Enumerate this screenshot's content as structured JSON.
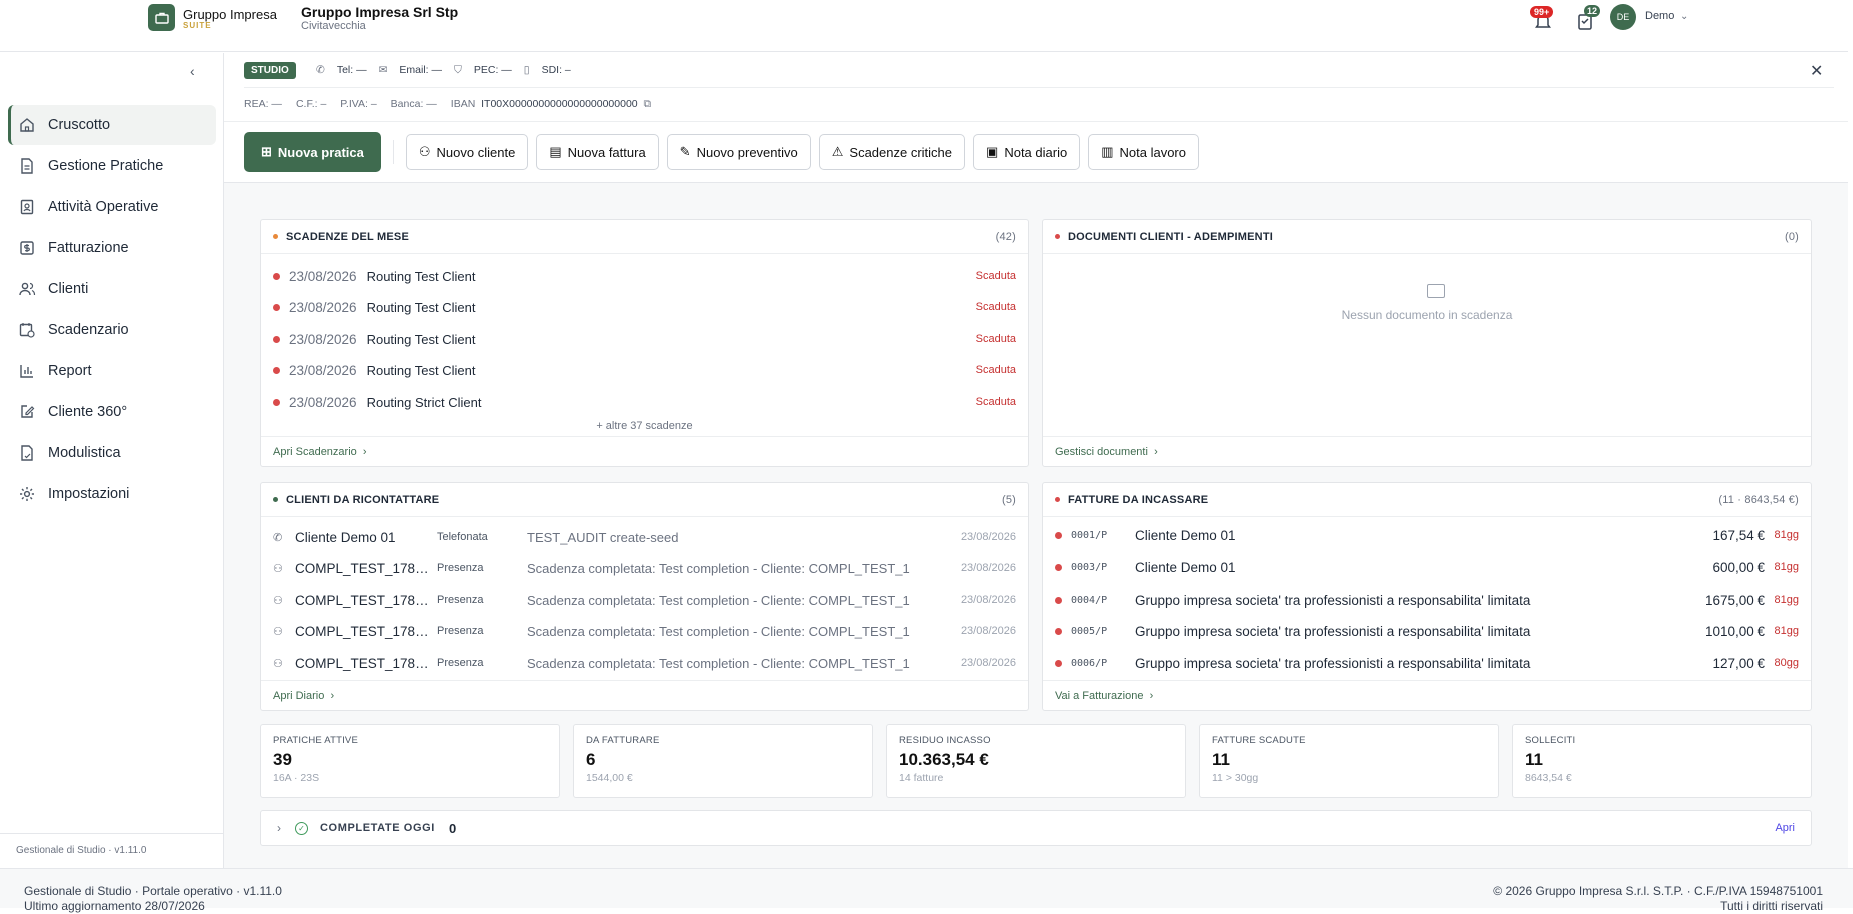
{
  "header": {
    "brand_name": "Gruppo Impresa",
    "brand_suite": "SUITE",
    "company_name": "Gruppo Impresa Srl Stp",
    "company_city": "Civitavecchia",
    "notifications_badge": "99+",
    "tasks_badge": "12",
    "user_initials": "DE",
    "user_name": "Demo"
  },
  "sidebar": {
    "items": [
      {
        "label": "Cruscotto",
        "icon": "home-icon"
      },
      {
        "label": "Gestione Pratiche",
        "icon": "document-icon"
      },
      {
        "label": "Attività Operative",
        "icon": "clipboard-icon"
      },
      {
        "label": "Fatturazione",
        "icon": "dollar-icon"
      },
      {
        "label": "Clienti",
        "icon": "users-icon"
      },
      {
        "label": "Scadenzario",
        "icon": "calendar-clock-icon"
      },
      {
        "label": "Report",
        "icon": "bar-chart-icon"
      },
      {
        "label": "Cliente 360°",
        "icon": "edit-icon"
      },
      {
        "label": "Modulistica",
        "icon": "form-icon"
      },
      {
        "label": "Impostazioni",
        "icon": "gear-icon"
      }
    ],
    "version": "Gestionale di Studio · v1.11.0"
  },
  "studio_info": {
    "chip": "STUDIO",
    "tel": "Tel: —",
    "email": "Email: —",
    "pec": "PEC: —",
    "sdi": "SDI: –",
    "rea": "REA: —",
    "cf": "C.F.: –",
    "piva": "P.IVA: –",
    "banca": "Banca: —",
    "iban_label": "IBAN",
    "iban": "IT00X0000000000000000000000"
  },
  "actions": {
    "new_practice": "Nuova pratica",
    "new_client": "Nuovo cliente",
    "new_invoice": "Nuova fattura",
    "new_quote": "Nuovo preventivo",
    "critical_deadlines": "Scadenze critiche",
    "diary_note": "Nota diario",
    "work_note": "Nota lavoro"
  },
  "deadlines": {
    "title": "SCADENZE DEL MESE",
    "count": "(42)",
    "rows": [
      {
        "date": "23/08/2026",
        "client": "Routing Test Client",
        "status": "Scaduta"
      },
      {
        "date": "23/08/2026",
        "client": "Routing Test Client",
        "status": "Scaduta"
      },
      {
        "date": "23/08/2026",
        "client": "Routing Test Client",
        "status": "Scaduta"
      },
      {
        "date": "23/08/2026",
        "client": "Routing Test Client",
        "status": "Scaduta"
      },
      {
        "date": "23/08/2026",
        "client": "Routing Strict Client",
        "status": "Scaduta"
      }
    ],
    "more": "+ altre 37 scadenze",
    "footer": "Apri Scadenzario"
  },
  "documents": {
    "title": "DOCUMENTI CLIENTI - ADEMPIMENTI",
    "count": "(0)",
    "empty": "Nessun documento in scadenza",
    "footer": "Gestisci documenti"
  },
  "recontact": {
    "title": "CLIENTI DA RICONTATTARE",
    "count": "(5)",
    "rows": [
      {
        "name": "Cliente Demo 01",
        "type": "Telefonata",
        "note": "TEST_AUDIT create-seed",
        "date": "23/08/2026"
      },
      {
        "name": "COMPL_TEST_1787...",
        "type": "Presenza",
        "note": "Scadenza completata: Test completion - Cliente: COMPL_TEST_1",
        "date": "23/08/2026"
      },
      {
        "name": "COMPL_TEST_1787...",
        "type": "Presenza",
        "note": "Scadenza completata: Test completion - Cliente: COMPL_TEST_1",
        "date": "23/08/2026"
      },
      {
        "name": "COMPL_TEST_1787...",
        "type": "Presenza",
        "note": "Scadenza completata: Test completion - Cliente: COMPL_TEST_1",
        "date": "23/08/2026"
      },
      {
        "name": "COMPL_TEST_1787...",
        "type": "Presenza",
        "note": "Scadenza completata: Test completion - Cliente: COMPL_TEST_1",
        "date": "23/08/2026"
      }
    ],
    "footer": "Apri Diario"
  },
  "invoices": {
    "title": "FATTURE DA INCASSARE",
    "count": "(11 · 8643,54 €)",
    "rows": [
      {
        "num": "0001/P",
        "client": "Cliente Demo 01",
        "amount": "167,54 €",
        "days": "81gg"
      },
      {
        "num": "0003/P",
        "client": "Cliente Demo 01",
        "amount": "600,00 €",
        "days": "81gg"
      },
      {
        "num": "0004/P",
        "client": "Gruppo impresa societa' tra professionisti a responsabilita' limitata",
        "amount": "1675,00 €",
        "days": "81gg"
      },
      {
        "num": "0005/P",
        "client": "Gruppo impresa societa' tra professionisti a responsabilita' limitata",
        "amount": "1010,00 €",
        "days": "81gg"
      },
      {
        "num": "0006/P",
        "client": "Gruppo impresa societa' tra professionisti a responsabilita' limitata",
        "amount": "127,00 €",
        "days": "80gg"
      }
    ],
    "footer": "Vai a Fatturazione"
  },
  "stats": [
    {
      "label": "PRATICHE ATTIVE",
      "value": "39",
      "sub": "16A · 23S"
    },
    {
      "label": "DA FATTURARE",
      "value": "6",
      "sub": "1544,00 €"
    },
    {
      "label": "RESIDUO INCASSO",
      "value": "10.363,54 €",
      "sub": "14 fatture"
    },
    {
      "label": "FATTURE SCADUTE",
      "value": "11",
      "sub": "11 > 30gg"
    },
    {
      "label": "SOLLECITI",
      "value": "11",
      "sub": "8643,54 €"
    }
  ],
  "completed_today": {
    "label": "COMPLETATE OGGI",
    "count": "0",
    "open": "Apri"
  },
  "footer": {
    "left_line1": "Gestionale di Studio · Portale operativo · v1.11.0",
    "left_line2": "Ultimo aggiornamento 28/07/2026",
    "right_line1": "© 2026 Gruppo Impresa S.r.l. S.T.P. · C.F./P.IVA 15948751001",
    "right_line2": "Tutti i diritti riservati"
  },
  "colors": {
    "brand": "#3f6b4f",
    "danger": "#dc2626",
    "suite_gold": "#c9a13b"
  }
}
